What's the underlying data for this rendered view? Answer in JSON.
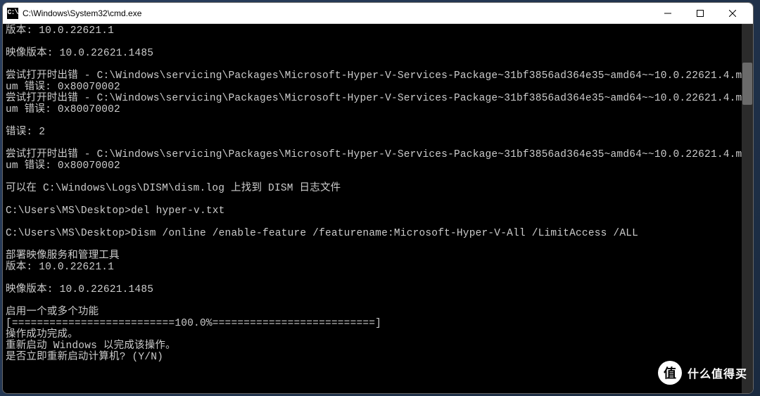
{
  "window": {
    "title": "C:\\Windows\\System32\\cmd.exe",
    "icon_text": "C:\\"
  },
  "console": {
    "lines": [
      "版本: 10.0.22621.1",
      "",
      "映像版本: 10.0.22621.1485",
      "",
      "尝试打开时出错 - C:\\Windows\\servicing\\Packages\\Microsoft-Hyper-V-Services-Package~31bf3856ad364e35~amd64~~10.0.22621.4.m",
      "um 错误: 0x80070002",
      "尝试打开时出错 - C:\\Windows\\servicing\\Packages\\Microsoft-Hyper-V-Services-Package~31bf3856ad364e35~amd64~~10.0.22621.4.m",
      "um 错误: 0x80070002",
      "",
      "错误: 2",
      "",
      "尝试打开时出错 - C:\\Windows\\servicing\\Packages\\Microsoft-Hyper-V-Services-Package~31bf3856ad364e35~amd64~~10.0.22621.4.m",
      "um 错误: 0x80070002",
      "",
      "可以在 C:\\Windows\\Logs\\DISM\\dism.log 上找到 DISM 日志文件",
      "",
      "C:\\Users\\MS\\Desktop>del hyper-v.txt",
      "",
      "C:\\Users\\MS\\Desktop>Dism /online /enable-feature /featurename:Microsoft-Hyper-V-All /LimitAccess /ALL",
      "",
      "部署映像服务和管理工具",
      "版本: 10.0.22621.1",
      "",
      "映像版本: 10.0.22621.1485",
      "",
      "启用一个或多个功能",
      "[==========================100.0%==========================]",
      "操作成功完成。",
      "重新启动 Windows 以完成该操作。",
      "是否立即重新启动计算机? (Y/N)"
    ]
  },
  "watermark": {
    "circle": "值",
    "text": "什么值得买"
  },
  "controls": {
    "minimize": "—",
    "maximize": "☐",
    "close": "✕"
  }
}
